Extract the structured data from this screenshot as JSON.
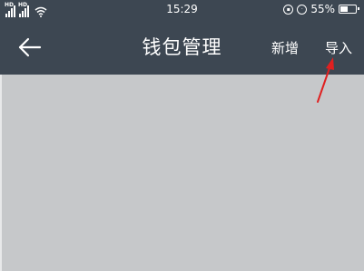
{
  "status_bar": {
    "network_label": "HD",
    "time": "15:29",
    "battery_percent": "55%",
    "battery_level": 0.55,
    "icons": [
      "signal-icon",
      "signal-icon",
      "wifi-icon",
      "lock-rotation-icon",
      "alarm-icon",
      "battery-icon"
    ]
  },
  "app_bar": {
    "title": "钱包管理",
    "back_icon": "arrow-left-icon",
    "actions": {
      "new_label": "新增",
      "import_label": "导入"
    },
    "background": "#3d4752",
    "text_color": "#ffffff"
  },
  "annotation": {
    "arrow_color": "#e02020",
    "target": "导入"
  },
  "content": {
    "background": "#c6c8ca"
  }
}
